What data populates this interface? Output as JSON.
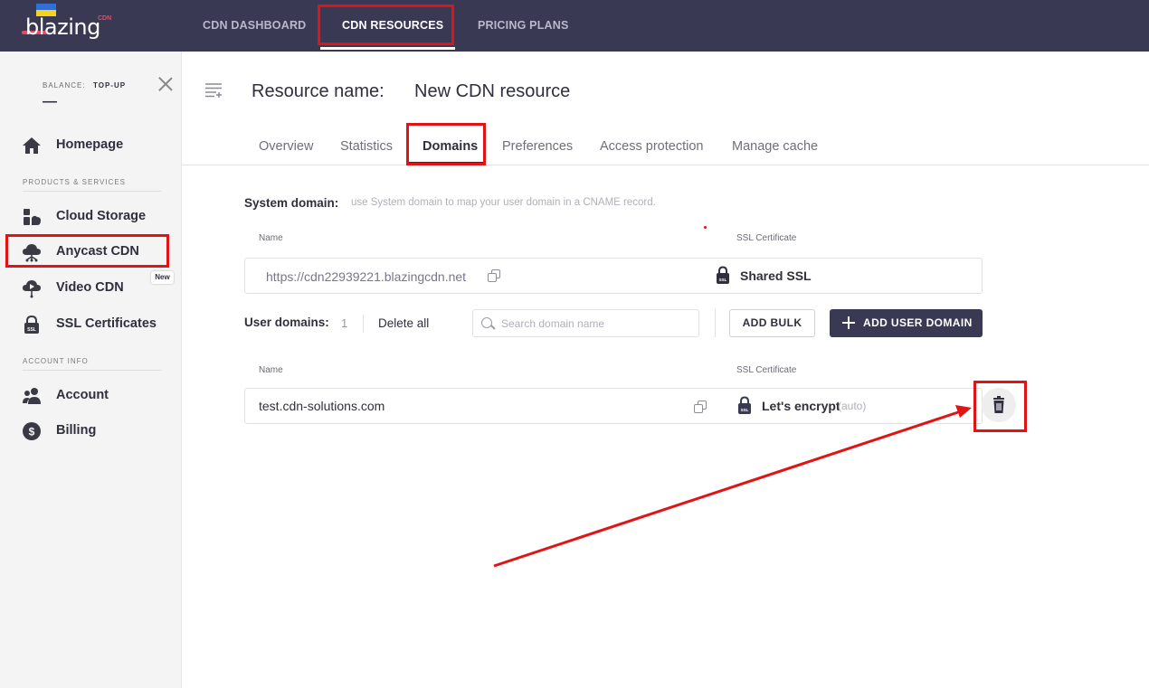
{
  "brand": {
    "logo_text": "blazing",
    "logo_suffix": "CDN"
  },
  "topnav": {
    "items": [
      {
        "label": "CDN DASHBOARD"
      },
      {
        "label": "CDN RESOURCES"
      },
      {
        "label": "PRICING PLANS"
      }
    ],
    "active_index": 1
  },
  "sidebar": {
    "balance_label": "BALANCE:",
    "topup_label": "TOP-UP",
    "balance_value": "—",
    "homepage": "Homepage",
    "section_products": "PRODUCTS & SERVICES",
    "products": [
      {
        "label": "Cloud Storage"
      },
      {
        "label": "Anycast CDN"
      },
      {
        "label": "Video CDN",
        "badge": "New"
      },
      {
        "label": "SSL Certificates"
      }
    ],
    "section_account": "ACCOUNT INFO",
    "account": [
      {
        "label": "Account"
      },
      {
        "label": "Billing"
      }
    ]
  },
  "main": {
    "title_label": "Resource name:",
    "title_value": "New CDN resource",
    "tabs": [
      {
        "label": "Overview"
      },
      {
        "label": "Statistics"
      },
      {
        "label": "Domains"
      },
      {
        "label": "Preferences"
      },
      {
        "label": "Access protection"
      },
      {
        "label": "Manage cache"
      }
    ],
    "active_tab_index": 2,
    "system_domain": {
      "label": "System domain:",
      "hint": "use System domain to map your user domain in a CNAME record.",
      "col_name": "Name",
      "col_ssl": "SSL Certificate",
      "domain": "https://cdn22939221.blazingcdn.net",
      "ssl": "Shared SSL"
    },
    "user_domains": {
      "label": "User domains:",
      "count": "1",
      "delete_all": "Delete all",
      "search_placeholder": "Search domain name",
      "add_bulk": "ADD BULK",
      "add_user_domain": "ADD USER DOMAIN",
      "col_name": "Name",
      "col_ssl": "SSL Certificate",
      "rows": [
        {
          "domain": "test.cdn-solutions.com",
          "ssl": "Let's encrypt",
          "ssl_note": "(auto)"
        }
      ]
    }
  },
  "colors": {
    "topbar": "#3a3954",
    "highlight": "#e01414",
    "primary_button": "#3a3954"
  }
}
